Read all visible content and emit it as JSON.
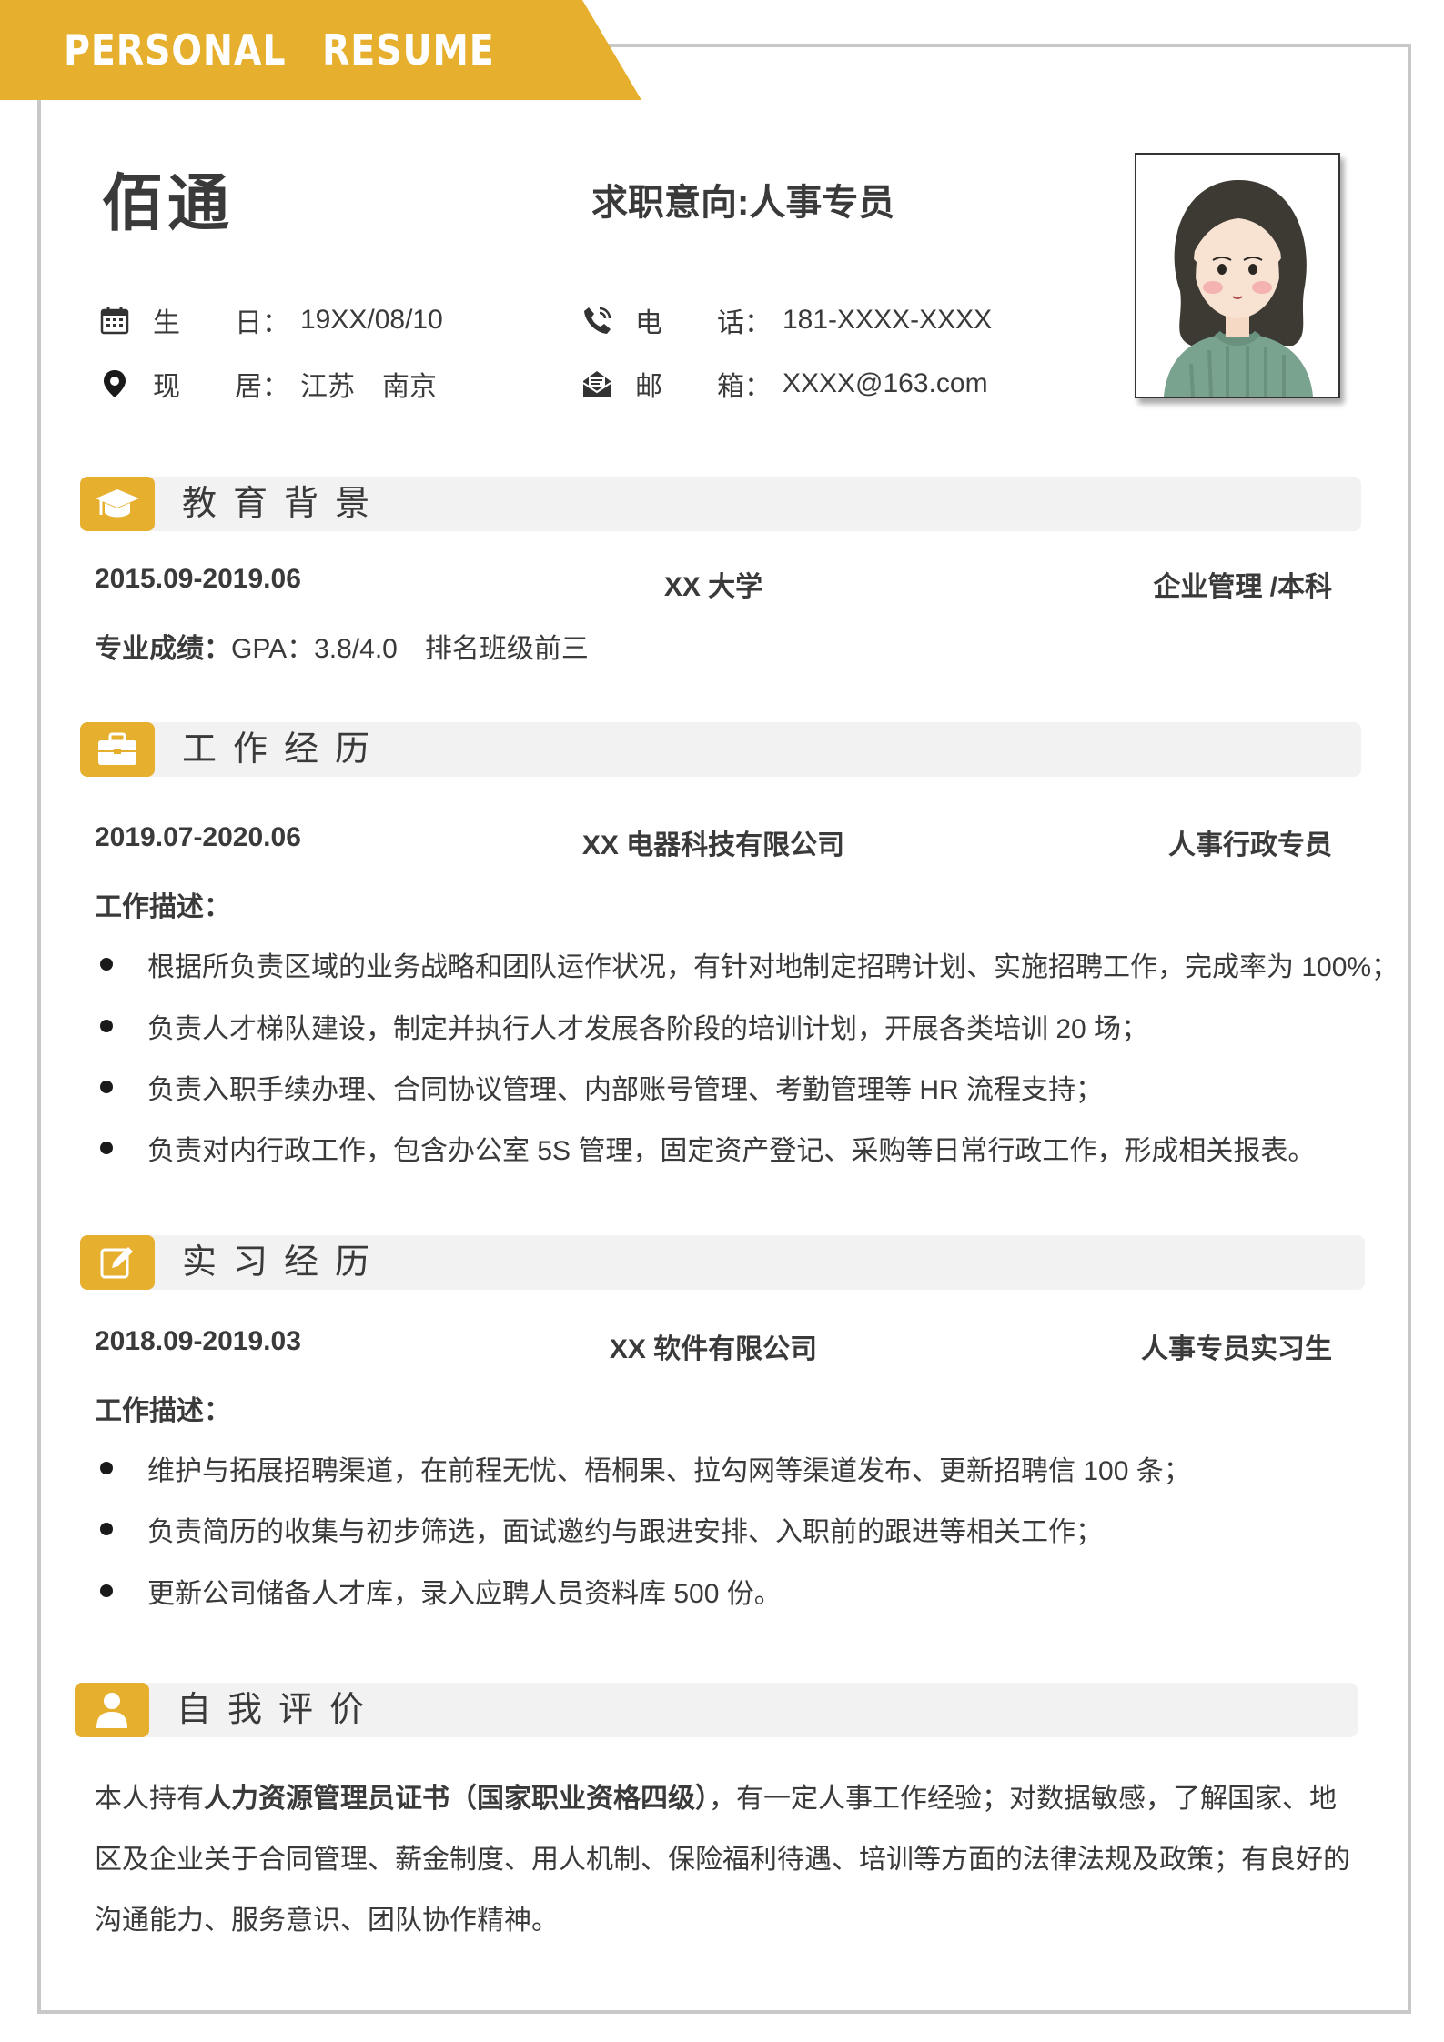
{
  "banner": {
    "word1": "PERSONAL",
    "word2": "RESUME"
  },
  "header": {
    "name": "佰通",
    "objective": "求职意向:人事专员"
  },
  "info": {
    "birthday": {
      "label_a": "生",
      "label_b": "日：",
      "value": "19XX/08/10",
      "icon": "calendar-icon"
    },
    "phone": {
      "label_a": "电",
      "label_b": "话：",
      "value": "181-XXXX-XXXX",
      "icon": "phone-icon"
    },
    "residence": {
      "label_a": "现",
      "label_b": "居：",
      "value": "江苏　南京",
      "icon": "location-pin-icon"
    },
    "email": {
      "label_a": "邮",
      "label_b": "箱：",
      "value": "XXXX@163.com",
      "icon": "mail-icon"
    }
  },
  "education": {
    "title": "教育背景",
    "icon": "graduation-cap-icon",
    "period": "2015.09-2019.06",
    "school": "XX 大学",
    "major": "企业管理 /本科",
    "score_label": "专业成绩：",
    "score_value": "GPA：3.8/4.0　排名班级前三"
  },
  "work": {
    "title": "工作经历",
    "icon": "briefcase-icon",
    "period": "2019.07-2020.06",
    "company": "XX 电器科技有限公司",
    "position": "人事行政专员",
    "desc_label": "工作描述：",
    "items": [
      "根据所负责区域的业务战略和团队运作状况，有针对地制定招聘计划、实施招聘工作，完成率为 100%；",
      "负责人才梯队建设，制定并执行人才发展各阶段的培训计划，开展各类培训 20 场；",
      "负责入职手续办理、合同协议管理、内部账号管理、考勤管理等 HR 流程支持；",
      "负责对内行政工作，包含办公室 5S 管理，固定资产登记、采购等日常行政工作，形成相关报表。"
    ]
  },
  "internship": {
    "title": "实习经历",
    "icon": "edit-icon",
    "period": "2018.09-2019.03",
    "company": "XX 软件有限公司",
    "position": "人事专员实习生",
    "desc_label": "工作描述：",
    "items": [
      "维护与拓展招聘渠道，在前程无忧、梧桐果、拉勾网等渠道发布、更新招聘信 100 条；",
      "负责简历的收集与初步筛选，面试邀约与跟进安排、入职前的跟进等相关工作；",
      "更新公司储备人才库，录入应聘人员资料库 500 份。"
    ]
  },
  "self": {
    "title": "自我评价",
    "icon": "user-icon",
    "text_pre": "本人持有",
    "text_bold": "人力资源管理员证书（国家职业资格四级）",
    "text_post": "，有一定人事工作经验；对数据敏感，了解国家、地区及企业关于合同管理、薪金制度、用人机制、保险福利待遇、培训等方面的法律法规及政策；有良好的沟通能力、服务意识、团队协作精神。"
  },
  "colors": {
    "accent": "#e6b02e",
    "section_bg": "#f2f2f2",
    "text": "#3a3a3a",
    "frame": "#c8c8c8"
  }
}
